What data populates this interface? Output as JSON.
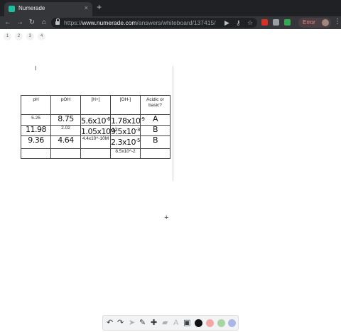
{
  "browser": {
    "tab_title": "Numerade",
    "tab_close": "×",
    "new_tab": "+",
    "url_prefix": "https://",
    "url_host": "www.numerade.com",
    "url_path": "/answers/whiteboard/137415/",
    "error_label": "Error",
    "favicon_color": "#1ebfa0"
  },
  "page_tabs": [
    "1",
    "2",
    "3",
    "4"
  ],
  "table": {
    "headers": [
      "pH",
      "pOH",
      "[H+]",
      "[OH-]",
      "Acidic or basic?"
    ],
    "rows": [
      {
        "typed": [
          "5.25",
          "",
          "",
          "",
          ""
        ],
        "handwritten": [
          "",
          "8.75",
          "5.6x10",
          "1.78x10",
          "A"
        ],
        "handwritten_sup": [
          "",
          "",
          "-6",
          "-9",
          ""
        ]
      },
      {
        "typed": [
          "",
          "2.02",
          "",
          "",
          ""
        ],
        "handwritten": [
          "11.98",
          "",
          "1.05x10",
          "9.5x10",
          "B"
        ],
        "handwritten_sup": [
          "",
          "",
          "-12",
          "-3",
          ""
        ]
      },
      {
        "typed": [
          "",
          "",
          "4.4x10^-10M",
          "",
          ""
        ],
        "handwritten": [
          "9.36",
          "4.64",
          "",
          "2.3x10",
          "B"
        ],
        "handwritten_sup": [
          "",
          "",
          "",
          "-5",
          ""
        ]
      },
      {
        "typed": [
          "",
          "",
          "",
          "8.5x10^-2",
          ""
        ],
        "handwritten": [
          "",
          "",
          "",
          "",
          ""
        ],
        "handwritten_sup": [
          "",
          "",
          "",
          "",
          ""
        ]
      }
    ]
  },
  "canvas": {
    "text_cursor": "I",
    "crosshair": "+"
  },
  "draw_toolbar": {
    "tools": [
      {
        "name": "undo-icon",
        "glyph": "↶"
      },
      {
        "name": "redo-icon",
        "glyph": "↷"
      },
      {
        "name": "select-icon",
        "glyph": "➤"
      },
      {
        "name": "pen-icon",
        "glyph": "✎"
      },
      {
        "name": "add-icon",
        "glyph": "✚"
      },
      {
        "name": "eraser-icon",
        "glyph": "▰"
      },
      {
        "name": "text-icon",
        "glyph": "A"
      },
      {
        "name": "image-icon",
        "glyph": "▣"
      }
    ],
    "colors": [
      "#111111",
      "#f4a7a7",
      "#a8d5a2",
      "#a9b7e8"
    ]
  }
}
